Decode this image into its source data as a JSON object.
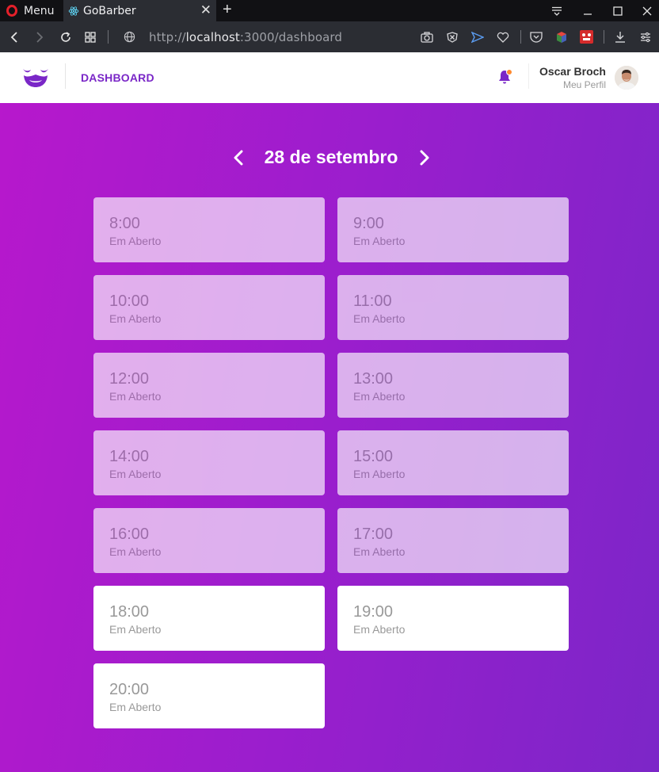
{
  "browser": {
    "menu_label": "Menu",
    "tab_title": "GoBarber",
    "url_scheme": "http://",
    "url_host": "localhost",
    "url_path": ":3000/dashboard"
  },
  "header": {
    "nav_label": "DASHBOARD",
    "user_name": "Oscar Broch",
    "profile_link": "Meu Perfil",
    "accent_color": "#7a27c7",
    "notification_badge_color": "#ff892e"
  },
  "schedule": {
    "date_title": "28 de setembro",
    "slots": [
      {
        "time": "8:00",
        "status": "Em Aberto",
        "past": true
      },
      {
        "time": "9:00",
        "status": "Em Aberto",
        "past": true
      },
      {
        "time": "10:00",
        "status": "Em Aberto",
        "past": true
      },
      {
        "time": "11:00",
        "status": "Em Aberto",
        "past": true
      },
      {
        "time": "12:00",
        "status": "Em Aberto",
        "past": true
      },
      {
        "time": "13:00",
        "status": "Em Aberto",
        "past": true
      },
      {
        "time": "14:00",
        "status": "Em Aberto",
        "past": true
      },
      {
        "time": "15:00",
        "status": "Em Aberto",
        "past": true
      },
      {
        "time": "16:00",
        "status": "Em Aberto",
        "past": true
      },
      {
        "time": "17:00",
        "status": "Em Aberto",
        "past": true
      },
      {
        "time": "18:00",
        "status": "Em Aberto",
        "past": false
      },
      {
        "time": "19:00",
        "status": "Em Aberto",
        "past": false
      },
      {
        "time": "20:00",
        "status": "Em Aberto",
        "past": false
      }
    ]
  }
}
